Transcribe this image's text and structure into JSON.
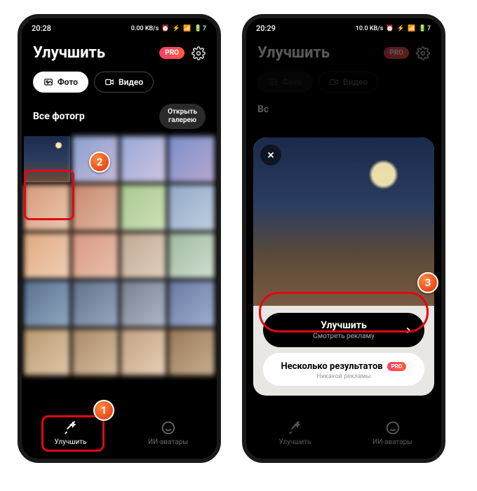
{
  "left": {
    "status": {
      "time": "20:28",
      "net": "0.00 KB/s",
      "icons": "⏰ ⚡ 📶 🔋7"
    },
    "title": "Улучшить",
    "pro": "PRO",
    "tabs": {
      "photo": "Фото",
      "video": "Видео"
    },
    "section": {
      "title": "Все фотогр",
      "open1": "Открыть",
      "open2": "галерею"
    },
    "nav": {
      "enhance": "Улучшить",
      "avatars": "ИИ-аватары"
    },
    "callouts": {
      "one": "1",
      "two": "2"
    }
  },
  "right": {
    "status": {
      "time": "20:29",
      "net": "10.0 KB/s",
      "icons": "⏰ ⚡ 📶 🔋7"
    },
    "title": "Улучшить",
    "pro": "PRO",
    "tabs": {
      "photo": "Фото",
      "video": "Видео"
    },
    "section": {
      "title": "Вс"
    },
    "sheet": {
      "primary_main": "Улучшить",
      "primary_sub": "Смотреть рекламу",
      "secondary_main": "Несколько результатов",
      "secondary_sub": "Никакой рекламы",
      "pro": "PRO"
    },
    "nav": {
      "enhance": "Улучшить",
      "avatars": "ИИ-аватары"
    },
    "callouts": {
      "three": "3"
    }
  }
}
